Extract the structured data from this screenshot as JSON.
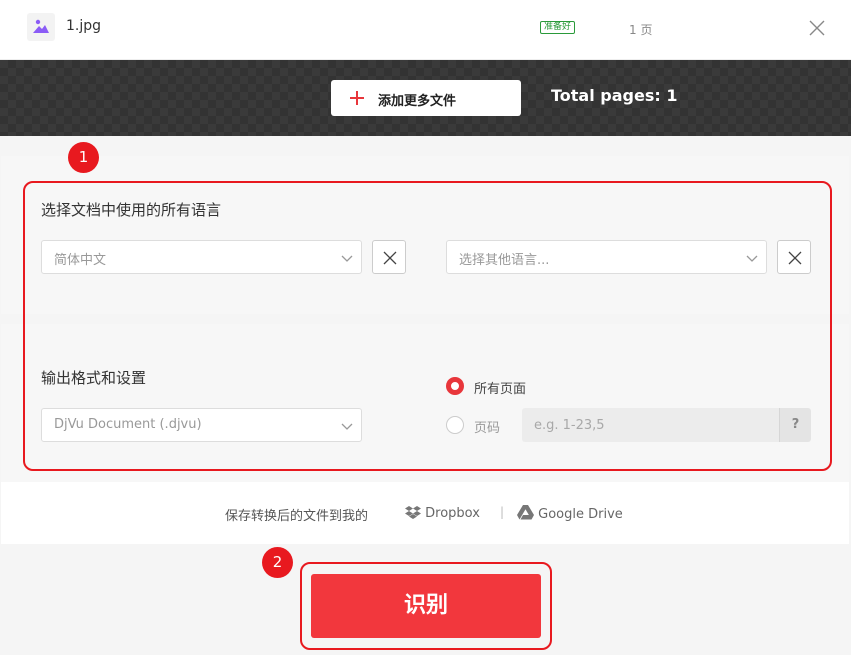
{
  "file": {
    "name": "1.jpg",
    "status": "准备好",
    "pages": "1 页"
  },
  "toolbar": {
    "add_files_label": "添加更多文件",
    "total_pages": "Total pages: 1"
  },
  "language_section": {
    "title": "选择文档中使用的所有语言",
    "primary_language": "简体中文",
    "other_language_placeholder": "选择其他语言..."
  },
  "output_section": {
    "title": "输出格式和设置",
    "format_value": "DjVu Document (.djvu)",
    "all_pages_label": "所有页面",
    "page_range_label": "页码",
    "page_range_placeholder": "e.g. 1-23,5",
    "help_label": "?"
  },
  "save": {
    "label": "保存转换后的文件到我的",
    "dropbox": "Dropbox",
    "separator": "|",
    "google_drive": "Google Drive"
  },
  "annotations": {
    "step1": "1",
    "step2": "2"
  },
  "ocr_button_label": "识别",
  "colors": {
    "accent": "#e8363b",
    "highlight": "#e8191f",
    "thumb_icon": "#8b5cf6",
    "ready_green": "#2a9a3a"
  }
}
